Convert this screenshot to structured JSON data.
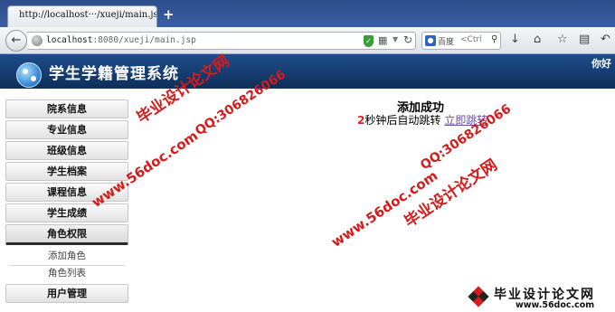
{
  "browser": {
    "tab_title": "http://localhost···/xueji/main.jsp",
    "new_tab": "+",
    "url_host": "localhost",
    "url_rest": ":8080/xueji/main.jsp",
    "search_engine": "百度",
    "search_placeholder": "<Ctrl"
  },
  "app": {
    "title": "学生学籍管理系统",
    "greeting": "你好"
  },
  "sidebar": {
    "items": [
      {
        "label": "院系信息"
      },
      {
        "label": "专业信息"
      },
      {
        "label": "班级信息"
      },
      {
        "label": "学生档案"
      },
      {
        "label": "课程信息"
      },
      {
        "label": "学生成绩"
      },
      {
        "label": "角色权限"
      }
    ],
    "subitems": [
      {
        "label": "添加角色"
      },
      {
        "label": "角色列表"
      }
    ],
    "last_item": {
      "label": "用户管理"
    }
  },
  "main": {
    "success_title": "添加成功",
    "countdown_number": "2",
    "countdown_text": "秒钟后自动跳转",
    "jump_link": "立即跳转"
  },
  "watermark": {
    "site_cn": "毕业设计论文网",
    "site_url": "www.56doc.com",
    "qq": "QQ:306826066",
    "footer_url": "www.56doc.com"
  }
}
